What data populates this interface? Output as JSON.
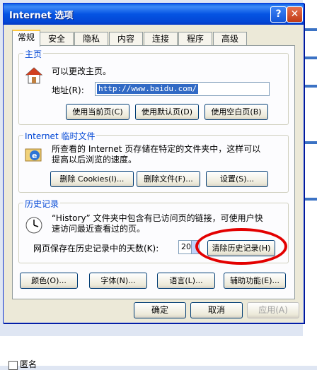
{
  "window": {
    "title": "Internet 选项"
  },
  "tabs": [
    "常规",
    "安全",
    "隐私",
    "内容",
    "连接",
    "程序",
    "高级"
  ],
  "home": {
    "group_title": "主页",
    "description": "可以更改主页。",
    "address_label": "地址(R):",
    "address_value": "http://www.baidu.com/",
    "buttons": [
      "使用当前页(C)",
      "使用默认页(D)",
      "使用空白页(B)"
    ]
  },
  "temp_files": {
    "group_title": "Internet 临时文件",
    "description_line1": "所查看的 Internet 页存储在特定的文件夹中，这样可以",
    "description_line2": "提高以后浏览的速度。",
    "buttons": [
      "删除 Cookies(I)...",
      "删除文件(F)...",
      "设置(S)..."
    ]
  },
  "history": {
    "group_title": "历史记录",
    "description_line1": "“History” 文件夹中包含有已访问页的链接，可使用户快",
    "description_line2": "速访问最近查看过的页。",
    "days_label": "网页保存在历史记录中的天数(K):",
    "days_value": "20",
    "clear_button": "清除历史记录(H)"
  },
  "bottom_buttons": [
    "颜色(O)...",
    "字体(N)...",
    "语言(L)...",
    "辅助功能(E)..."
  ],
  "dialog_buttons": {
    "ok": "确定",
    "cancel": "取消",
    "apply": "应用(A)"
  },
  "background": {
    "checkbox_label": "匿名"
  },
  "colors": {
    "title_bar": "#0554e3",
    "group_title": "#0046d5",
    "highlight_oval": "#e30000"
  }
}
